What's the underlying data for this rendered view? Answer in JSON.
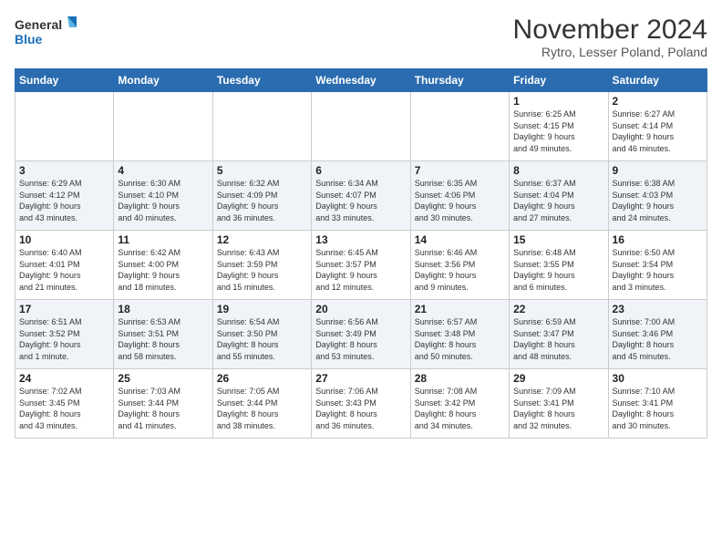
{
  "logo": {
    "line1": "General",
    "line2": "Blue"
  },
  "title": "November 2024",
  "subtitle": "Rytro, Lesser Poland, Poland",
  "days_header": [
    "Sunday",
    "Monday",
    "Tuesday",
    "Wednesday",
    "Thursday",
    "Friday",
    "Saturday"
  ],
  "weeks": [
    [
      {
        "day": "",
        "info": ""
      },
      {
        "day": "",
        "info": ""
      },
      {
        "day": "",
        "info": ""
      },
      {
        "day": "",
        "info": ""
      },
      {
        "day": "",
        "info": ""
      },
      {
        "day": "1",
        "info": "Sunrise: 6:25 AM\nSunset: 4:15 PM\nDaylight: 9 hours\nand 49 minutes."
      },
      {
        "day": "2",
        "info": "Sunrise: 6:27 AM\nSunset: 4:14 PM\nDaylight: 9 hours\nand 46 minutes."
      }
    ],
    [
      {
        "day": "3",
        "info": "Sunrise: 6:29 AM\nSunset: 4:12 PM\nDaylight: 9 hours\nand 43 minutes."
      },
      {
        "day": "4",
        "info": "Sunrise: 6:30 AM\nSunset: 4:10 PM\nDaylight: 9 hours\nand 40 minutes."
      },
      {
        "day": "5",
        "info": "Sunrise: 6:32 AM\nSunset: 4:09 PM\nDaylight: 9 hours\nand 36 minutes."
      },
      {
        "day": "6",
        "info": "Sunrise: 6:34 AM\nSunset: 4:07 PM\nDaylight: 9 hours\nand 33 minutes."
      },
      {
        "day": "7",
        "info": "Sunrise: 6:35 AM\nSunset: 4:06 PM\nDaylight: 9 hours\nand 30 minutes."
      },
      {
        "day": "8",
        "info": "Sunrise: 6:37 AM\nSunset: 4:04 PM\nDaylight: 9 hours\nand 27 minutes."
      },
      {
        "day": "9",
        "info": "Sunrise: 6:38 AM\nSunset: 4:03 PM\nDaylight: 9 hours\nand 24 minutes."
      }
    ],
    [
      {
        "day": "10",
        "info": "Sunrise: 6:40 AM\nSunset: 4:01 PM\nDaylight: 9 hours\nand 21 minutes."
      },
      {
        "day": "11",
        "info": "Sunrise: 6:42 AM\nSunset: 4:00 PM\nDaylight: 9 hours\nand 18 minutes."
      },
      {
        "day": "12",
        "info": "Sunrise: 6:43 AM\nSunset: 3:59 PM\nDaylight: 9 hours\nand 15 minutes."
      },
      {
        "day": "13",
        "info": "Sunrise: 6:45 AM\nSunset: 3:57 PM\nDaylight: 9 hours\nand 12 minutes."
      },
      {
        "day": "14",
        "info": "Sunrise: 6:46 AM\nSunset: 3:56 PM\nDaylight: 9 hours\nand 9 minutes."
      },
      {
        "day": "15",
        "info": "Sunrise: 6:48 AM\nSunset: 3:55 PM\nDaylight: 9 hours\nand 6 minutes."
      },
      {
        "day": "16",
        "info": "Sunrise: 6:50 AM\nSunset: 3:54 PM\nDaylight: 9 hours\nand 3 minutes."
      }
    ],
    [
      {
        "day": "17",
        "info": "Sunrise: 6:51 AM\nSunset: 3:52 PM\nDaylight: 9 hours\nand 1 minute."
      },
      {
        "day": "18",
        "info": "Sunrise: 6:53 AM\nSunset: 3:51 PM\nDaylight: 8 hours\nand 58 minutes."
      },
      {
        "day": "19",
        "info": "Sunrise: 6:54 AM\nSunset: 3:50 PM\nDaylight: 8 hours\nand 55 minutes."
      },
      {
        "day": "20",
        "info": "Sunrise: 6:56 AM\nSunset: 3:49 PM\nDaylight: 8 hours\nand 53 minutes."
      },
      {
        "day": "21",
        "info": "Sunrise: 6:57 AM\nSunset: 3:48 PM\nDaylight: 8 hours\nand 50 minutes."
      },
      {
        "day": "22",
        "info": "Sunrise: 6:59 AM\nSunset: 3:47 PM\nDaylight: 8 hours\nand 48 minutes."
      },
      {
        "day": "23",
        "info": "Sunrise: 7:00 AM\nSunset: 3:46 PM\nDaylight: 8 hours\nand 45 minutes."
      }
    ],
    [
      {
        "day": "24",
        "info": "Sunrise: 7:02 AM\nSunset: 3:45 PM\nDaylight: 8 hours\nand 43 minutes."
      },
      {
        "day": "25",
        "info": "Sunrise: 7:03 AM\nSunset: 3:44 PM\nDaylight: 8 hours\nand 41 minutes."
      },
      {
        "day": "26",
        "info": "Sunrise: 7:05 AM\nSunset: 3:44 PM\nDaylight: 8 hours\nand 38 minutes."
      },
      {
        "day": "27",
        "info": "Sunrise: 7:06 AM\nSunset: 3:43 PM\nDaylight: 8 hours\nand 36 minutes."
      },
      {
        "day": "28",
        "info": "Sunrise: 7:08 AM\nSunset: 3:42 PM\nDaylight: 8 hours\nand 34 minutes."
      },
      {
        "day": "29",
        "info": "Sunrise: 7:09 AM\nSunset: 3:41 PM\nDaylight: 8 hours\nand 32 minutes."
      },
      {
        "day": "30",
        "info": "Sunrise: 7:10 AM\nSunset: 3:41 PM\nDaylight: 8 hours\nand 30 minutes."
      }
    ]
  ]
}
